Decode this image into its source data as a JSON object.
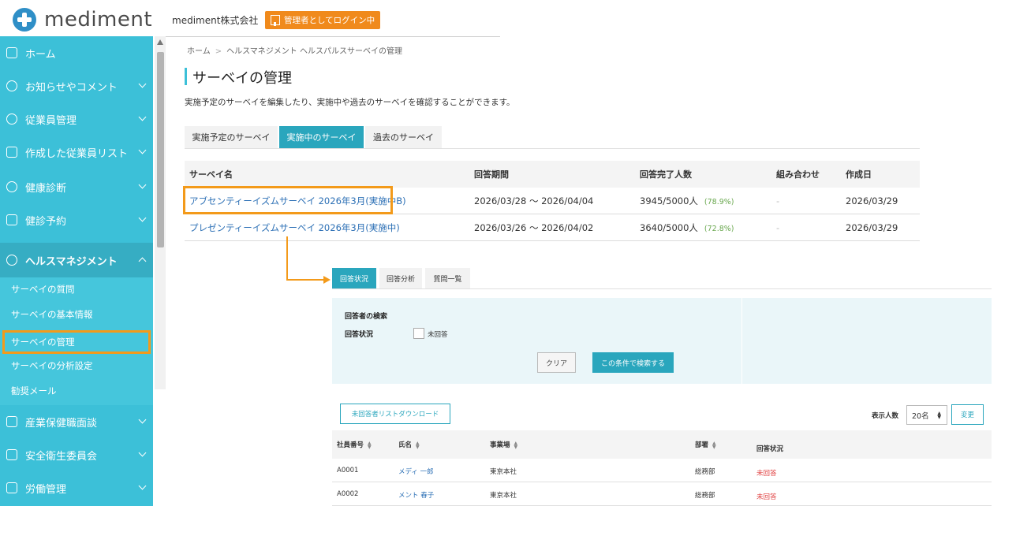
{
  "header": {
    "logo_text": "mediment",
    "company": "mediment株式会社",
    "admin_badge": "管理者としてログイン中"
  },
  "sidebar": {
    "items": [
      {
        "label": "ホーム"
      },
      {
        "label": "お知らせやコメント"
      },
      {
        "label": "従業員管理"
      },
      {
        "label": "作成した従業員リスト"
      },
      {
        "label": "健康診断"
      },
      {
        "label": "健診予約"
      },
      {
        "label": "ヘルスマネジメント"
      },
      {
        "label": "産業保健職面談"
      },
      {
        "label": "安全衛生委員会"
      },
      {
        "label": "労働管理"
      }
    ],
    "submenu": [
      {
        "label": "サーベイの質問"
      },
      {
        "label": "サーベイの基本情報"
      },
      {
        "label": "サーベイの管理"
      },
      {
        "label": "サーベイの分析設定"
      },
      {
        "label": "勧奨メール"
      }
    ]
  },
  "breadcrumb": {
    "home": "ホーム",
    "sep": ">",
    "current": "ヘルスマネジメント ヘルスパルスサーベイの管理"
  },
  "page": {
    "title": "サーベイの管理",
    "description": "実施予定のサーベイを編集したり、実施中や過去のサーベイを確認することができます。"
  },
  "tabs": [
    {
      "label": "実施予定のサーベイ"
    },
    {
      "label": "実施中のサーベイ"
    },
    {
      "label": "過去のサーベイ"
    }
  ],
  "survey_table": {
    "headers": [
      "サーベイ名",
      "回答期間",
      "回答完了人数",
      "組み合わせ",
      "作成日"
    ],
    "rows": [
      {
        "name": "アブセンティーイズムサーベイ 2026年3月(実施中B)",
        "period": "2026/03/28 ～ 2026/04/04",
        "completed": "3945/5000人",
        "pct": "(78.9%)",
        "combo": "-",
        "created": "2026/03/29"
      },
      {
        "name": "プレゼンティーイズムサーベイ 2026年3月(実施中)",
        "period": "2026/03/26 ～ 2026/04/02",
        "completed": "3640/5000人",
        "pct": "(72.8%)",
        "combo": "-",
        "created": "2026/03/29"
      }
    ]
  },
  "detail": {
    "tabs": [
      {
        "label": "回答状況"
      },
      {
        "label": "回答分析"
      },
      {
        "label": "質問一覧"
      }
    ],
    "search": {
      "title": "回答者の検索",
      "status_label": "回答状況",
      "checkbox_label": "未回答",
      "clear_label": "クリア",
      "search_label": "この条件で検索する"
    },
    "download_label": "未回答者リストダウンロード",
    "per_page_label": "表示人数",
    "per_page_value": "20名",
    "change_label": "変更",
    "table": {
      "headers": [
        "社員番号",
        "氏名",
        "事業場",
        "部署",
        "回答状況"
      ],
      "rows": [
        {
          "id": "A0001",
          "name": "メディ 一郎",
          "site": "東京本社",
          "dept": "総務部",
          "status": "未回答"
        },
        {
          "id": "A0002",
          "name": "メント 春子",
          "site": "東京本社",
          "dept": "総務部",
          "status": "未回答"
        }
      ]
    }
  },
  "colors": {
    "sidebar": "#3cc0d8",
    "accent": "#2aa6bd",
    "highlight": "#f39a1a",
    "badge": "#f08a1c"
  }
}
